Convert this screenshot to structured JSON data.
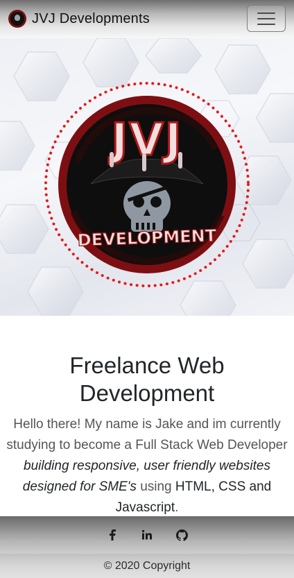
{
  "navbar": {
    "brand": "JVJ Developments",
    "brand_logo_icon": "jvj-skull-logo-icon",
    "toggler_icon": "hamburger-menu-icon"
  },
  "hero": {
    "logo": {
      "top_text": "JVJ",
      "bottom_text": "DEVELOPMENT",
      "icon": "pirate-skull-icon",
      "ring_color": "#e02020",
      "badge_color": "#7d0f12"
    }
  },
  "main": {
    "headline": "Freelance Web Development",
    "intro_part1": "Hello there! My name is Jake and im currently studying to become a Full Stack Web Developer ",
    "intro_emphasis": "building responsive, user friendly websites designed for SME's",
    "intro_part2": " using ",
    "intro_tech": "HTML, CSS and Javascript",
    "intro_end": "."
  },
  "footer": {
    "social": [
      {
        "icon": "facebook-icon",
        "glyph": "f"
      },
      {
        "icon": "linkedin-icon",
        "glyph": "in"
      },
      {
        "icon": "github-icon",
        "glyph": ""
      }
    ],
    "copyright": "© 2020 Copyright"
  }
}
